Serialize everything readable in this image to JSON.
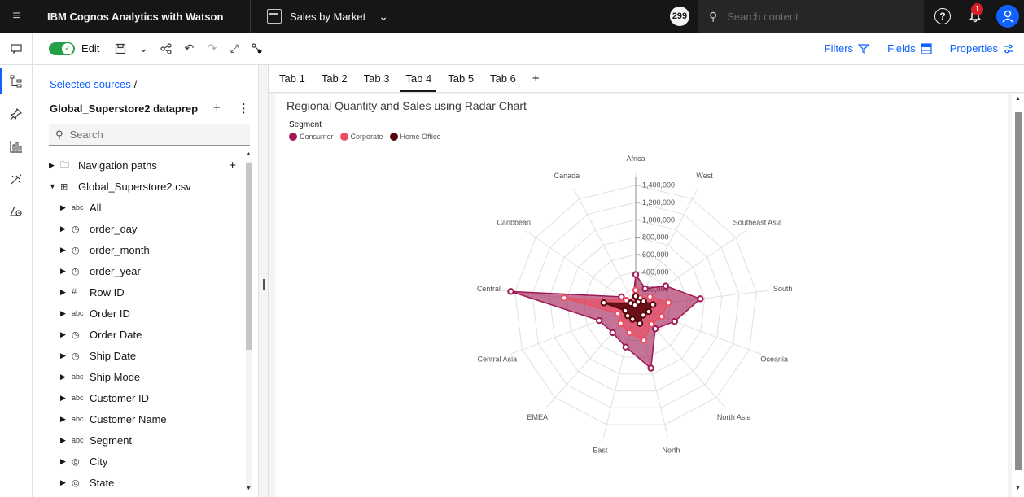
{
  "topbar": {
    "brand_bold": "IBM Cognos Analytics with Watson",
    "report_name": "Sales by Market",
    "count_badge": "299",
    "search_placeholder": "Search content",
    "notification_count": "1",
    "menu_icon": "hamburger-icon",
    "help_icon": "help-icon",
    "notification_icon": "notification-icon",
    "avatar_icon": "user-avatar-icon"
  },
  "toolbar": {
    "edit_label": "Edit",
    "edit_toggle_on": true,
    "filters_label": "Filters",
    "fields_label": "Fields",
    "properties_label": "Properties"
  },
  "leftrail": {
    "items": [
      {
        "name": "sources-icon",
        "active": true
      },
      {
        "name": "pin-icon",
        "active": false
      },
      {
        "name": "visualizations-icon",
        "active": false
      },
      {
        "name": "assistant-icon",
        "active": false
      },
      {
        "name": "insights-icon",
        "active": false
      }
    ]
  },
  "sources": {
    "breadcrumb": "Selected sources",
    "breadcrumb_sep": "/",
    "dataset_name": "Global_Superstore2 dataprep",
    "search_placeholder": "Search",
    "tree": [
      {
        "label": "Navigation paths",
        "type": "folder",
        "level": 0
      },
      {
        "label": "Global_Superstore2.csv",
        "type": "table",
        "level": 0,
        "expanded": true
      },
      {
        "label": "All",
        "type": "abc",
        "level": 1
      },
      {
        "label": "order_day",
        "type": "clock",
        "level": 1
      },
      {
        "label": "order_month",
        "type": "clock",
        "level": 1
      },
      {
        "label": "order_year",
        "type": "clock",
        "level": 1
      },
      {
        "label": "Row ID",
        "type": "hash",
        "level": 1
      },
      {
        "label": "Order ID",
        "type": "abc",
        "level": 1
      },
      {
        "label": "Order Date",
        "type": "clock",
        "level": 1
      },
      {
        "label": "Ship Date",
        "type": "clock",
        "level": 1
      },
      {
        "label": "Ship Mode",
        "type": "abc",
        "level": 1
      },
      {
        "label": "Customer ID",
        "type": "abc",
        "level": 1
      },
      {
        "label": "Customer Name",
        "type": "abc",
        "level": 1
      },
      {
        "label": "Segment",
        "type": "abc",
        "level": 1
      },
      {
        "label": "City",
        "type": "pin",
        "level": 1
      },
      {
        "label": "State",
        "type": "pin",
        "level": 1
      }
    ]
  },
  "tabs": [
    "Tab 1",
    "Tab 2",
    "Tab 3",
    "Tab 4",
    "Tab 5",
    "Tab 6"
  ],
  "active_tab": 3,
  "chart_data": {
    "type": "radar",
    "title": "Regional Quantity and Sales using Radar Chart",
    "legend_title": "Segment",
    "categories": [
      "Africa",
      "West",
      "Southeast Asia",
      "South",
      "Oceania",
      "North Asia",
      "North",
      "East",
      "EMEA",
      "Central Asia",
      "Central",
      "Caribbean",
      "Canada"
    ],
    "radial_ticks": [
      "200,000",
      "400,000",
      "600,000",
      "800,000",
      "1,000,000",
      "1,200,000",
      "1,400,000"
    ],
    "rmax": 1500000,
    "series": [
      {
        "name": "Consumer",
        "color": "#9f1853",
        "values": [
          370000,
          235000,
          420000,
          750000,
          480000,
          340000,
          730000,
          480000,
          400000,
          450000,
          1450000,
          200000,
          70000
        ]
      },
      {
        "name": "Corporate",
        "color": "#ee4d5f",
        "values": [
          190000,
          110000,
          200000,
          380000,
          320000,
          270000,
          400000,
          310000,
          260000,
          220000,
          830000,
          130000,
          40000
        ]
      },
      {
        "name": "Home Office",
        "color": "#570408",
        "values": [
          120000,
          60000,
          110000,
          200000,
          160000,
          130000,
          200000,
          150000,
          140000,
          130000,
          370000,
          70000,
          20000
        ]
      }
    ]
  }
}
